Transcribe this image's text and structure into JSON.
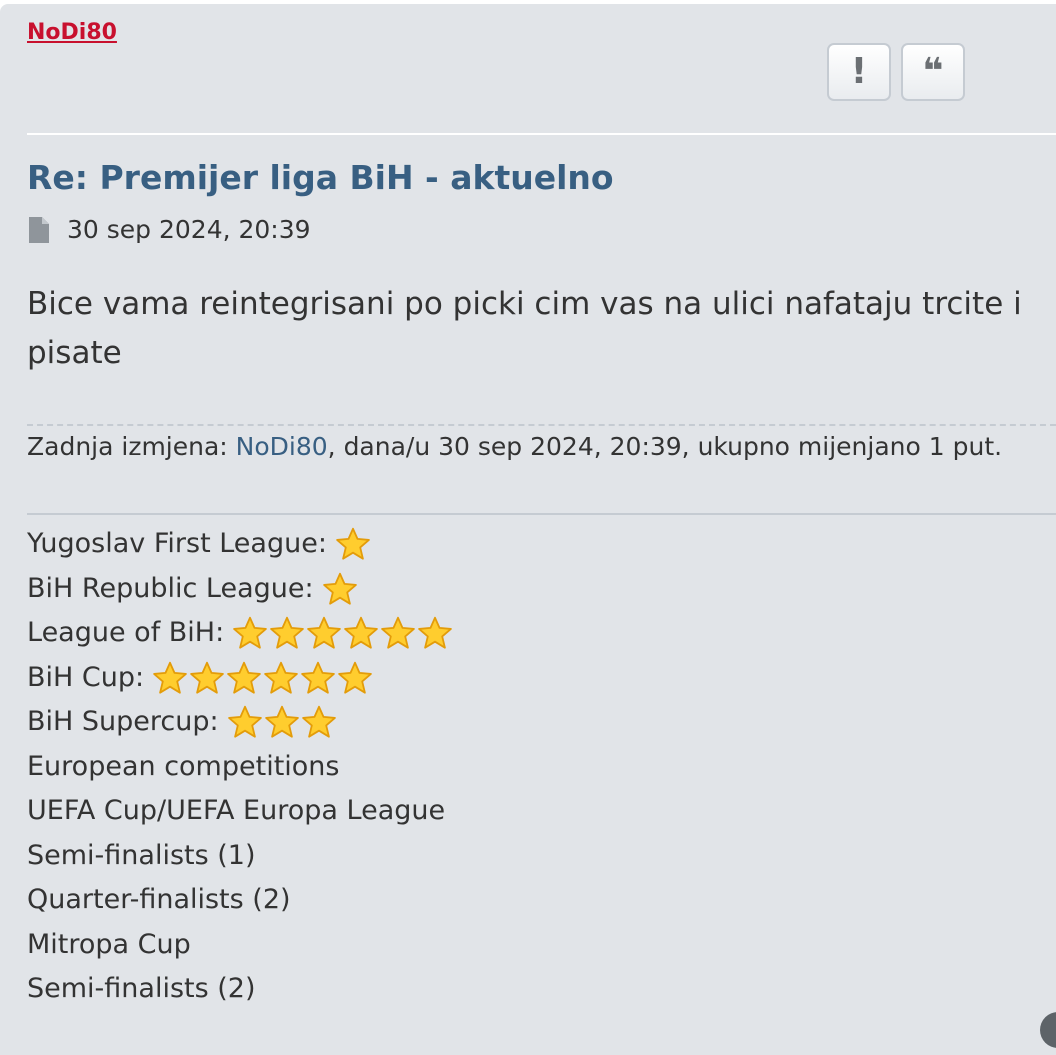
{
  "post": {
    "author": "NoDi80",
    "title": "Re: Premijer liga BiH - aktuelno",
    "date": "30 sep 2024, 20:39",
    "body": "Bice vama reintegrisani po picki cim vas na ulici nafataju trcite i pisate",
    "actions": {
      "report_glyph": "!",
      "quote_glyph": "❝"
    },
    "edit_note": {
      "prefix": "Zadnja izmjena: ",
      "user": "NoDi80",
      "suffix": ", dana/u 30 sep 2024, 20:39, ukupno mijenjano 1 put."
    }
  },
  "signature": [
    {
      "text": "Yugoslav First League:",
      "stars": 1
    },
    {
      "text": "BiH Republic League:",
      "stars": 1
    },
    {
      "text": "League of BiH:",
      "stars": 6
    },
    {
      "text": "BiH Cup:",
      "stars": 6
    },
    {
      "text": "BiH Supercup:",
      "stars": 3
    },
    {
      "text": "European competitions",
      "stars": 0
    },
    {
      "text": "UEFA Cup/UEFA Europa League",
      "stars": 0
    },
    {
      "text": "Semi-finalists (1)",
      "stars": 0
    },
    {
      "text": "Quarter-finalists (2)",
      "stars": 0
    },
    {
      "text": "Mitropa Cup",
      "stars": 0
    },
    {
      "text": "Semi-finalists (2)",
      "stars": 0
    }
  ],
  "colors": {
    "author": "#c8102e",
    "title": "#385f82",
    "background": "#e1e4e8",
    "star_fill": "#ffcd2e",
    "star_stroke": "#e39c0a"
  },
  "icons": {
    "report": "exclamation-icon",
    "quote": "quote-icon",
    "post": "document-icon",
    "star": "star-icon",
    "corner": "edit-icon"
  }
}
